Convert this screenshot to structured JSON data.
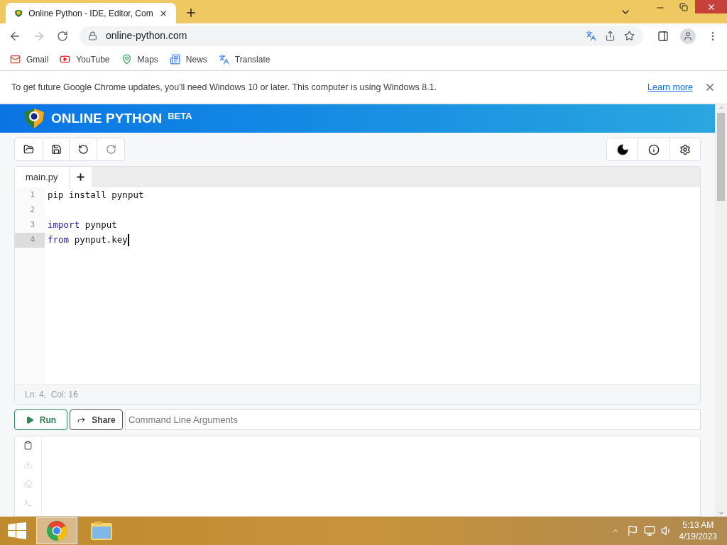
{
  "browser": {
    "tab": {
      "title": "Online Python - IDE, Editor, Com",
      "selected": true
    },
    "address": "online-python.com",
    "bookmarks": [
      "Gmail",
      "YouTube",
      "Maps",
      "News",
      "Translate"
    ],
    "infobar": {
      "message": "To get future Google Chrome updates, you'll need Windows 10 or later. This computer is using Windows 8.1.",
      "link": "Learn more"
    }
  },
  "app": {
    "title": "ONLINE PYTHON",
    "badge": "BETA",
    "file_tabs": [
      {
        "label": "main.py",
        "selected": true
      }
    ],
    "lines": [
      {
        "number": "1",
        "active": false,
        "cursor": false,
        "tokens": [
          {
            "kind": "plain",
            "text": "pip install pynput"
          }
        ]
      },
      {
        "number": "2",
        "active": false,
        "cursor": false
      },
      {
        "number": "3",
        "active": false,
        "cursor": false,
        "tokens": [
          {
            "kind": "keyword",
            "text": "import"
          },
          {
            "kind": "plain",
            "text": " pynput"
          }
        ]
      },
      {
        "number": "4",
        "active": true,
        "cursor": true,
        "tokens": [
          {
            "kind": "keyword",
            "text": "from"
          },
          {
            "kind": "plain",
            "text": " pynput.key"
          }
        ]
      }
    ],
    "status": "Ln: 4,  Col: 16",
    "run": "Run",
    "share": "Share",
    "args_placeholder": "Command Line Arguments"
  },
  "taskbar": {
    "time": "5:13 AM",
    "date": "4/19/2023"
  }
}
